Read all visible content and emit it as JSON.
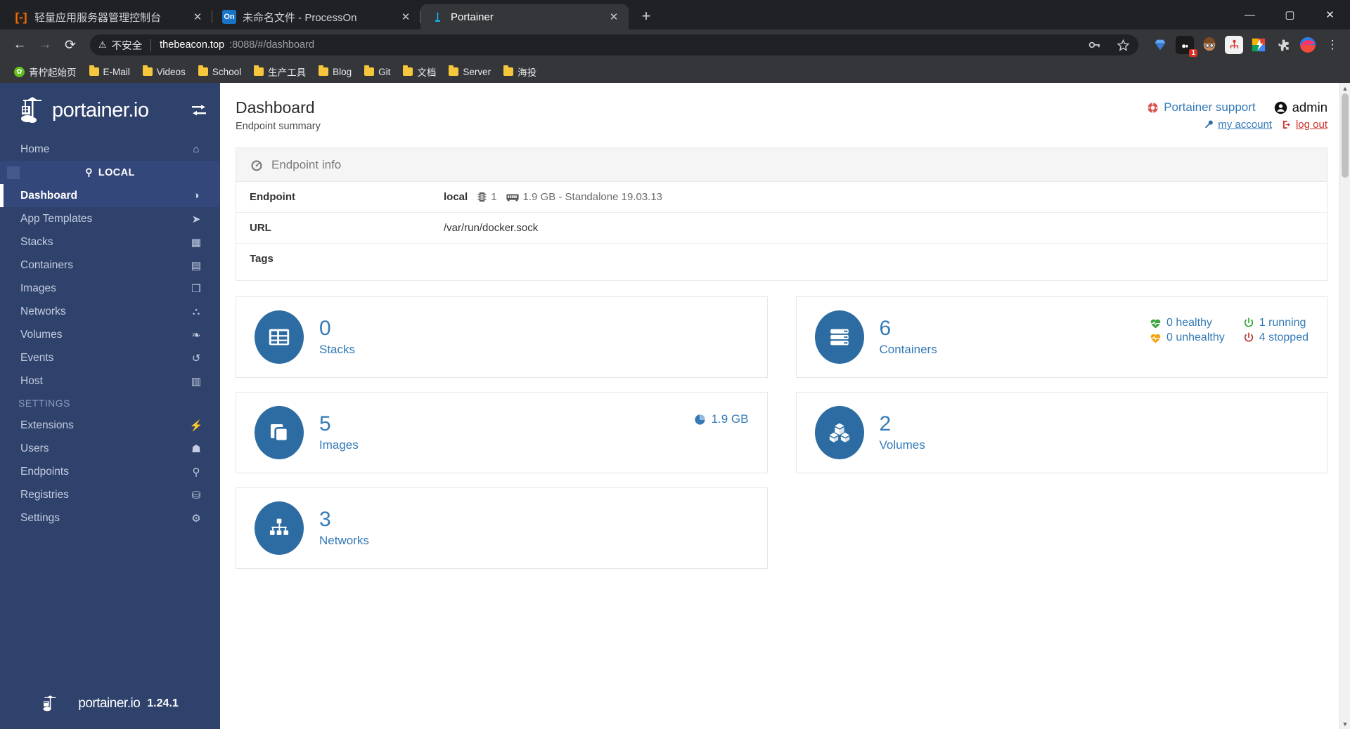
{
  "browser": {
    "tabs": [
      {
        "title": "轻量应用服务器管理控制台",
        "favicon": "console-icon",
        "favicon_text": "[-]",
        "active": false
      },
      {
        "title": "未命名文件 - ProcessOn",
        "favicon": "processon-icon",
        "favicon_text": "On",
        "active": false
      },
      {
        "title": "Portainer",
        "favicon": "portainer-icon",
        "favicon_text": "⚓",
        "active": true
      }
    ],
    "new_tab_label": "+",
    "window_controls": {
      "minimize": "—",
      "maximize": "▢",
      "close": "✕"
    },
    "nav": {
      "back": "←",
      "forward": "→",
      "reload": "⟳"
    },
    "omnibox": {
      "warning_icon": "⚠",
      "security_label": "不安全",
      "url_host": "thebeacon.top",
      "url_rest": ":8088/#/dashboard",
      "key_icon": "key-icon",
      "star_icon": "star-icon"
    },
    "extensions": [
      {
        "name": "diamond-extension",
        "glyph": "◆",
        "badge": ""
      },
      {
        "name": "notes-extension",
        "glyph": "▢",
        "badge": "1"
      },
      {
        "name": "avatar-extension",
        "glyph": "☻",
        "badge": ""
      },
      {
        "name": "sitemap-extension",
        "glyph": "⛭",
        "badge": ""
      },
      {
        "name": "colorful-extension",
        "glyph": "⚡",
        "badge": ""
      },
      {
        "name": "puzzle-extension",
        "glyph": "🧩",
        "badge": ""
      },
      {
        "name": "profile-avatar",
        "glyph": "●",
        "badge": ""
      },
      {
        "name": "chrome-menu",
        "glyph": "⋮",
        "badge": ""
      }
    ],
    "bookmarks": [
      {
        "label": "青柠起始页",
        "icon": "lime-icon"
      },
      {
        "label": "E-Mail",
        "icon": "folder-icon"
      },
      {
        "label": "Videos",
        "icon": "folder-icon"
      },
      {
        "label": "School",
        "icon": "folder-icon"
      },
      {
        "label": "生产工具",
        "icon": "folder-icon"
      },
      {
        "label": "Blog",
        "icon": "folder-icon"
      },
      {
        "label": "Git",
        "icon": "folder-icon"
      },
      {
        "label": "文档",
        "icon": "folder-icon"
      },
      {
        "label": "Server",
        "icon": "folder-icon"
      },
      {
        "label": "海投",
        "icon": "folder-icon"
      }
    ]
  },
  "sidebar": {
    "brand": "portainer.io",
    "toggle_icon": "collapse-icon",
    "home": {
      "label": "Home",
      "icon": "home-icon"
    },
    "local_label": "LOCAL",
    "local_icon": "plug-icon",
    "items": [
      {
        "label": "Dashboard",
        "icon": "dashboard-icon",
        "active": true
      },
      {
        "label": "App Templates",
        "icon": "rocket-icon",
        "active": false
      },
      {
        "label": "Stacks",
        "icon": "stacks-icon",
        "active": false
      },
      {
        "label": "Containers",
        "icon": "containers-icon",
        "active": false
      },
      {
        "label": "Images",
        "icon": "images-icon",
        "active": false
      },
      {
        "label": "Networks",
        "icon": "networks-icon",
        "active": false
      },
      {
        "label": "Volumes",
        "icon": "volumes-icon",
        "active": false
      },
      {
        "label": "Events",
        "icon": "history-icon",
        "active": false
      },
      {
        "label": "Host",
        "icon": "host-icon",
        "active": false
      }
    ],
    "settings_section": "SETTINGS",
    "settings_items": [
      {
        "label": "Extensions",
        "icon": "bolt-icon"
      },
      {
        "label": "Users",
        "icon": "users-icon"
      },
      {
        "label": "Endpoints",
        "icon": "plug-icon"
      },
      {
        "label": "Registries",
        "icon": "database-icon"
      },
      {
        "label": "Settings",
        "icon": "gears-icon"
      }
    ],
    "footer_brand": "portainer.io",
    "version": "1.24.1"
  },
  "header": {
    "title": "Dashboard",
    "subtitle": "Endpoint summary",
    "support_label": "Portainer support",
    "support_icon": "life-ring-icon",
    "user_label": "admin",
    "user_icon": "user-circle-icon",
    "my_account_label": "my account",
    "my_account_icon": "wrench-icon",
    "logout_label": "log out",
    "logout_icon": "sign-out-icon"
  },
  "endpoint_panel": {
    "title": "Endpoint info",
    "title_icon": "tachometer-icon",
    "rows": [
      {
        "key": "Endpoint",
        "value": "local",
        "cpu_icon": "microchip-icon",
        "cpu": "1",
        "mem_icon": "memory-icon",
        "mem": "1.9 GB - Standalone 19.03.13"
      },
      {
        "key": "URL",
        "value": "/var/run/docker.sock"
      },
      {
        "key": "Tags",
        "value": ""
      }
    ]
  },
  "cards": [
    {
      "name": "stacks",
      "count": "0",
      "label": "Stacks",
      "icon": "stacks-icon",
      "column": "left"
    },
    {
      "name": "containers",
      "count": "6",
      "label": "Containers",
      "icon": "containers-icon",
      "column": "right",
      "stats": [
        {
          "label": "0 healthy",
          "icon": "heartbeat-icon",
          "color": "#3ca33c"
        },
        {
          "label": "1 running",
          "icon": "power-icon",
          "color": "#23a123"
        },
        {
          "label": "0 unhealthy",
          "icon": "heartbeat-icon",
          "color": "#f0a30a"
        },
        {
          "label": "4 stopped",
          "icon": "power-icon",
          "color": "#b52b27"
        }
      ]
    },
    {
      "name": "images",
      "count": "5",
      "label": "Images",
      "icon": "images-icon",
      "column": "left",
      "size": "1.9 GB",
      "size_icon": "pie-chart-icon"
    },
    {
      "name": "volumes",
      "count": "2",
      "label": "Volumes",
      "icon": "volumes-icon",
      "column": "right"
    },
    {
      "name": "networks",
      "count": "3",
      "label": "Networks",
      "icon": "networks-icon",
      "column": "left"
    }
  ],
  "colors": {
    "sidebar_bg": "#2f426c",
    "sidebar_active": "#34477a",
    "accent_blue": "#337ab7",
    "badge_blue": "#2d6ca2",
    "danger_red": "#c9302c"
  }
}
